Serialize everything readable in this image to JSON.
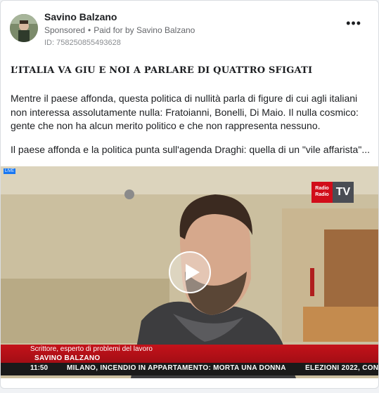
{
  "post": {
    "author": "Savino Balzano",
    "sponsored": "Sponsored",
    "paid_for": "Paid for by Savino Balzano",
    "ad_id": "ID: 758250855493628",
    "more_icon": "more-dots-icon"
  },
  "content": {
    "headline": "L’ITALIA VA GIU E NOI A PARLARE DI QUATTRO SFIGATI",
    "paragraph1": "Mentre il paese affonda, questa politica di nullità parla di figure di cui agli italiani non interessa assolutamente nulla: Fratoianni, Bonelli, Di Maio. Il nulla cosmico: gente che non ha alcun merito politico e che non rappresenta nessuno.",
    "paragraph2": "Il paese affonda e la politica punta sull'agenda Draghi: quella di un \"vile affarista\"..."
  },
  "video": {
    "live_badge": "LIVE",
    "logo_top": "Radio",
    "logo_mid": "Radio",
    "logo_tv": "TV",
    "role": "Scrittore, esperto di problemi del lavoro",
    "reporter": "SAVINO BALZANO",
    "time": "11:50",
    "ticker1": "MILANO, INCENDIO IN APPARTAMENTO: MORTA UNA DONNA",
    "ticker2": "ELEZIONI 2022, CON",
    "play_icon": "play-icon"
  },
  "colors": {
    "accent": "#1877f2",
    "lower_third": "#c4121a",
    "ticker_bg": "#1a1a1a"
  }
}
